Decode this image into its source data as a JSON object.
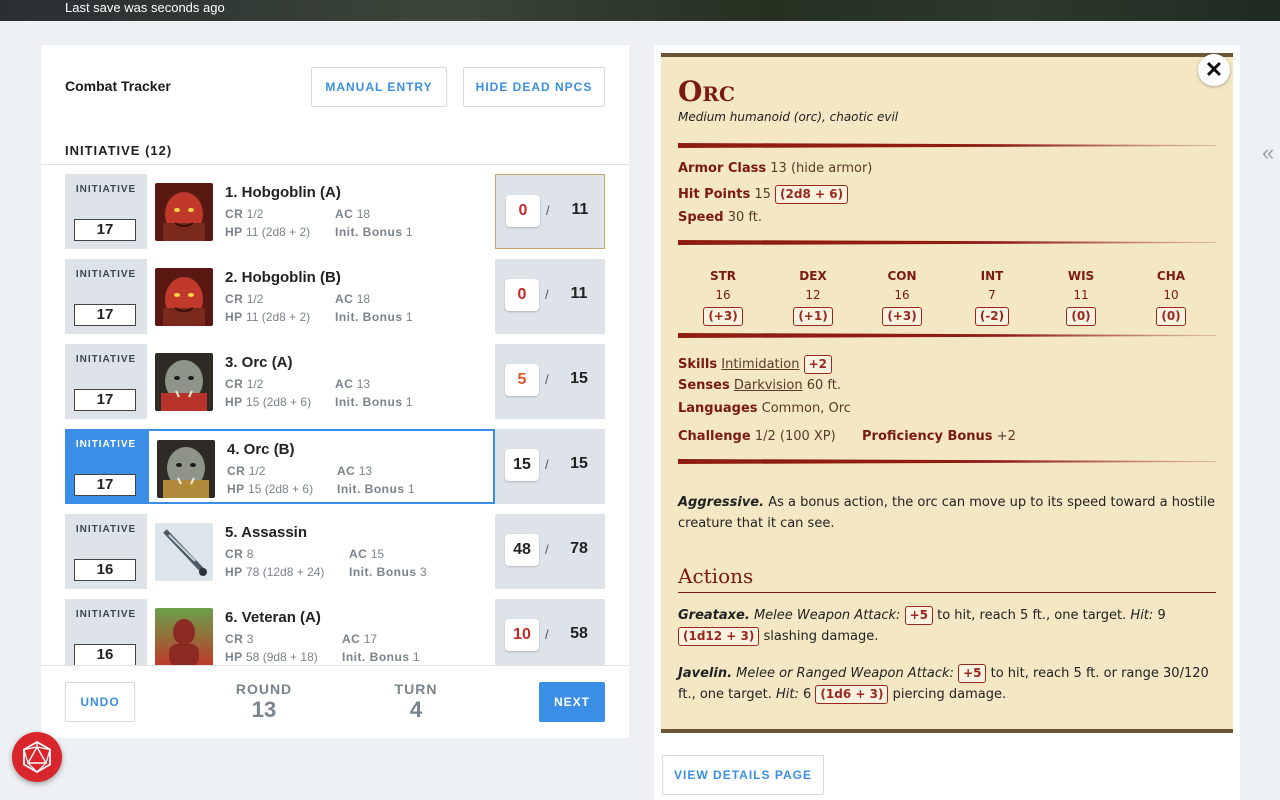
{
  "header": {
    "save_status": "Last save was seconds ago"
  },
  "tracker": {
    "title": "Combat Tracker",
    "manual_entry": "MANUAL ENTRY",
    "hide_dead": "HIDE DEAD NPCS",
    "initiative_heading": "INITIATIVE (12)",
    "init_label": "INITIATIVE",
    "labels": {
      "cr": "CR",
      "ac": "AC",
      "hp": "HP",
      "init_bonus": "Init. Bonus"
    },
    "combatants": [
      {
        "init": "17",
        "name": "1. Hobgoblin (A)",
        "cr": "1/2",
        "ac": "18",
        "hp": "11 (2d8 + 2)",
        "init_bonus": "1",
        "hp_cur": "0",
        "hp_max": "11",
        "hp_color": "#c62828",
        "avatar": "hobgoblin"
      },
      {
        "init": "17",
        "name": "2. Hobgoblin (B)",
        "cr": "1/2",
        "ac": "18",
        "hp": "11 (2d8 + 2)",
        "init_bonus": "1",
        "hp_cur": "0",
        "hp_max": "11",
        "hp_color": "#c62828",
        "avatar": "hobgoblin"
      },
      {
        "init": "17",
        "name": "3. Orc (A)",
        "cr": "1/2",
        "ac": "13",
        "hp": "15 (2d8 + 6)",
        "init_bonus": "1",
        "hp_cur": "5",
        "hp_max": "15",
        "hp_color": "#e0562a",
        "avatar": "orc"
      },
      {
        "init": "17",
        "name": "4. Orc (B)",
        "cr": "1/2",
        "ac": "13",
        "hp": "15 (2d8 + 6)",
        "init_bonus": "1",
        "hp_cur": "15",
        "hp_max": "15",
        "hp_color": "#222222",
        "avatar": "orc"
      },
      {
        "init": "16",
        "name": "5. Assassin",
        "cr": "8",
        "ac": "15",
        "hp": "78 (12d8 + 24)",
        "init_bonus": "3",
        "hp_cur": "48",
        "hp_max": "78",
        "hp_color": "#222222",
        "avatar": "dagger"
      },
      {
        "init": "16",
        "name": "6. Veteran (A)",
        "cr": "3",
        "ac": "17",
        "hp": "58 (9d8 + 18)",
        "init_bonus": "1",
        "hp_cur": "10",
        "hp_max": "58",
        "hp_color": "#c62828",
        "avatar": "veteran"
      }
    ],
    "undo": "UNDO",
    "round_label": "ROUND",
    "round_value": "13",
    "turn_label": "TURN",
    "turn_value": "4",
    "next": "NEXT"
  },
  "statblock": {
    "name": "Orc",
    "subtitle": "Medium humanoid (orc), chaotic evil",
    "armor_class_label": "Armor Class",
    "armor_class": "13 (hide armor)",
    "hit_points_label": "Hit Points",
    "hit_points": "15",
    "hit_points_roll": "(2d8 + 6)",
    "speed_label": "Speed",
    "speed": "30 ft.",
    "abilities": [
      {
        "name": "STR",
        "score": "16",
        "mod": "(+3)"
      },
      {
        "name": "DEX",
        "score": "12",
        "mod": "(+1)"
      },
      {
        "name": "CON",
        "score": "16",
        "mod": "(+3)"
      },
      {
        "name": "INT",
        "score": "7",
        "mod": "(-2)"
      },
      {
        "name": "WIS",
        "score": "11",
        "mod": "(0)"
      },
      {
        "name": "CHA",
        "score": "10",
        "mod": "(0)"
      }
    ],
    "skills_label": "Skills",
    "skills_name": "Intimidation",
    "skills_mod": "+2",
    "senses_label": "Senses",
    "senses_name": "Darkvision",
    "senses_value": "60 ft.",
    "languages_label": "Languages",
    "languages": "Common, Orc",
    "challenge_label": "Challenge",
    "challenge": "1/2 (100 XP)",
    "prof_label": "Proficiency Bonus",
    "prof": "+2",
    "trait_name": "Aggressive.",
    "trait_text": "As a bonus action, the orc can move up to its speed toward a hostile creature that it can see.",
    "actions_heading": "Actions",
    "greataxe": {
      "name": "Greataxe.",
      "attack_type": "Melee Weapon Attack:",
      "to_hit": "+5",
      "reach": "to hit, reach 5 ft., one target.",
      "hit_label": "Hit:",
      "avg": "9",
      "roll": "(1d12 + 3)",
      "damage": "slashing damage."
    },
    "javelin": {
      "name": "Javelin.",
      "attack_type": "Melee or Ranged Weapon Attack:",
      "to_hit": "+5",
      "reach": "to hit, reach 5 ft. or range 30/120 ft., one target.",
      "hit_label": "Hit:",
      "avg": "6",
      "roll": "(1d6 + 3)",
      "damage": "piercing damage."
    },
    "view_details": "VIEW DETAILS PAGE",
    "close_glyph": "✕"
  }
}
